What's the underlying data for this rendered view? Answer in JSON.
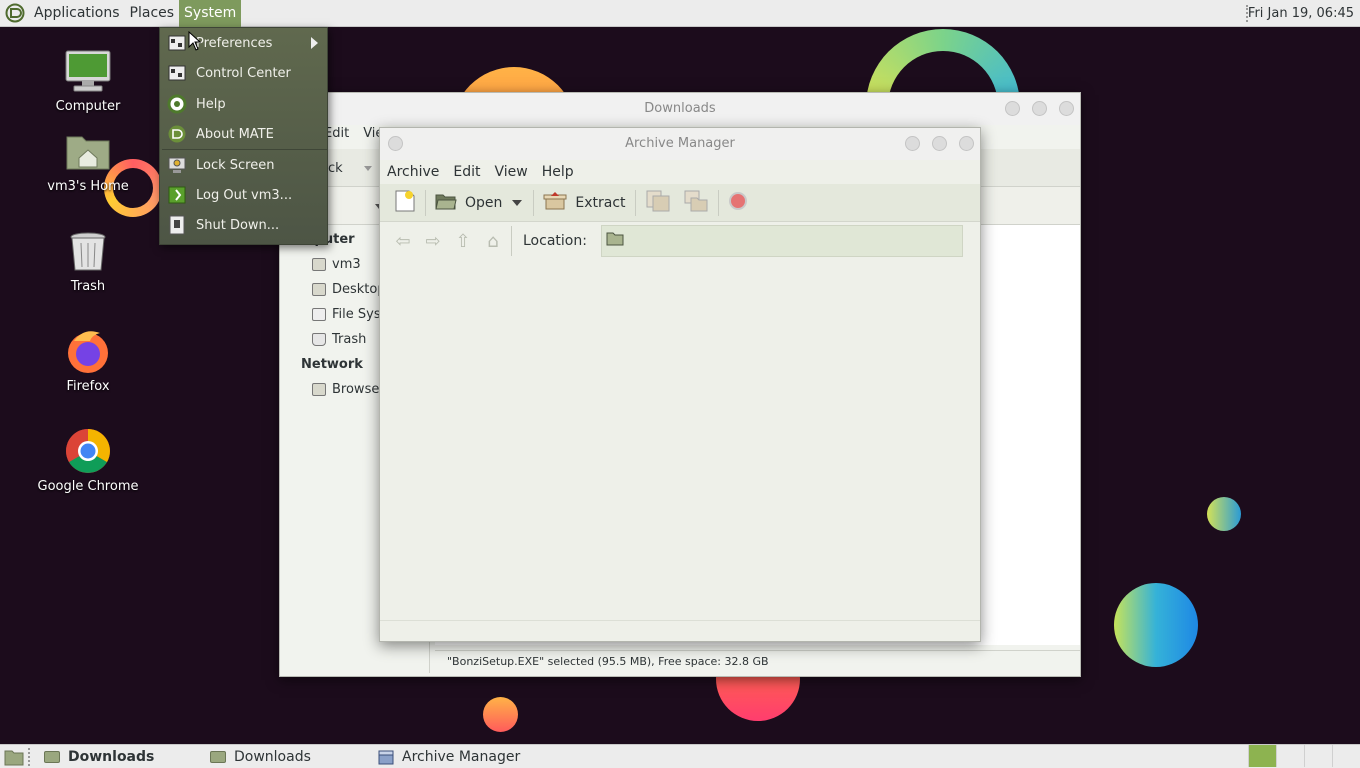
{
  "top_panel": {
    "menus": [
      "Applications",
      "Places",
      "System"
    ],
    "clock": "Fri Jan 19, 06:45"
  },
  "desktop": {
    "icons": [
      {
        "label": "Computer",
        "icon": "computer-icon"
      },
      {
        "label": "vm3's Home",
        "icon": "home-folder-icon"
      },
      {
        "label": "Trash",
        "icon": "trash-icon"
      },
      {
        "label": "Firefox",
        "icon": "firefox-icon"
      },
      {
        "label": "Google Chrome",
        "icon": "chrome-icon"
      }
    ]
  },
  "system_menu": {
    "items": [
      {
        "label": "Preferences",
        "icon": "preferences-icon",
        "submenu": true
      },
      {
        "label": "Control Center",
        "icon": "control-center-icon"
      },
      {
        "label": "Help",
        "icon": "help-icon"
      },
      {
        "label": "About MATE",
        "icon": "mate-icon"
      },
      {
        "label": "Lock Screen",
        "icon": "lock-icon"
      },
      {
        "label": "Log Out vm3...",
        "icon": "logout-icon"
      },
      {
        "label": "Shut Down...",
        "icon": "shutdown-icon"
      }
    ]
  },
  "downloads_window": {
    "title": "Downloads",
    "menu": [
      "Edit",
      "Vie"
    ],
    "back_label": "ack",
    "sidebar": {
      "computer_heading": "mputer",
      "computer_items": [
        "vm3",
        "Desktop",
        "File Syst",
        "Trash"
      ],
      "network_heading": "Network",
      "network_items": [
        "Browse"
      ]
    },
    "status": "\"BonziSetup.EXE\" selected (95.5 MB), Free space: 32.8 GB"
  },
  "archive_window": {
    "title": "Archive Manager",
    "menu": [
      "Archive",
      "Edit",
      "View",
      "Help"
    ],
    "toolbar": {
      "open_label": "Open",
      "extract_label": "Extract"
    },
    "location_label": "Location:"
  },
  "bottom_panel": {
    "tasks": [
      {
        "label": "Downloads",
        "active": true
      },
      {
        "label": "Downloads",
        "active": false
      },
      {
        "label": "Archive Manager",
        "active": false
      }
    ]
  }
}
